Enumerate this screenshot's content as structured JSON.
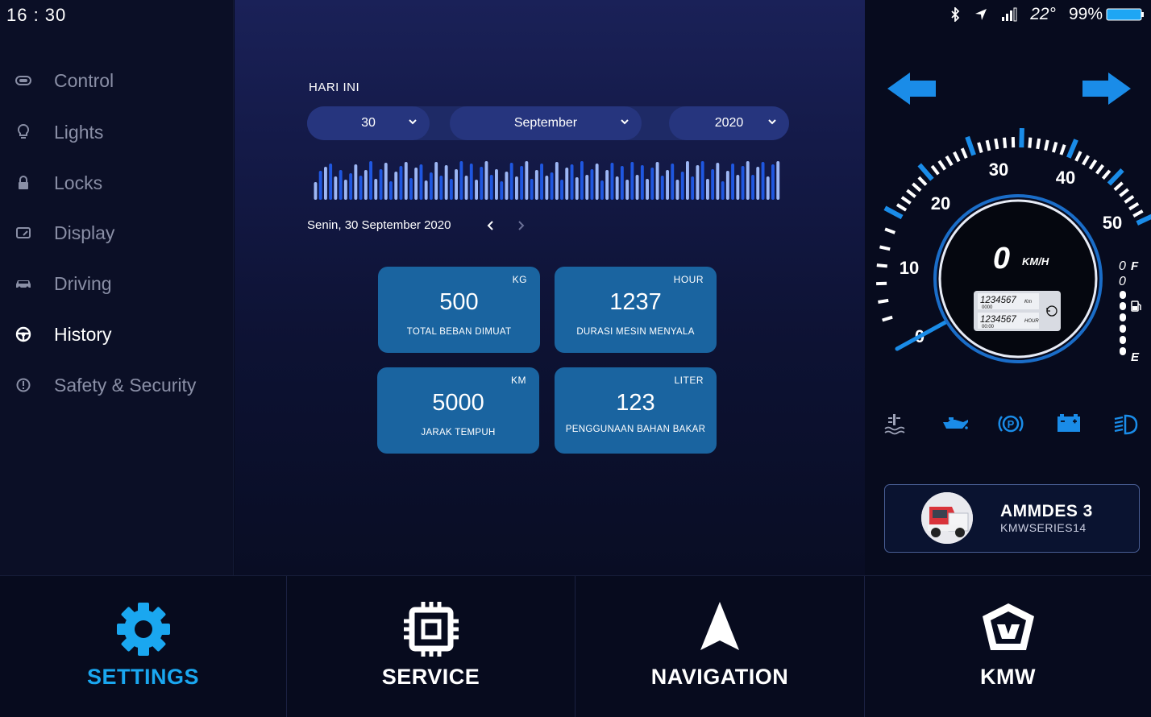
{
  "status_bar": {
    "time": "16 : 30",
    "temperature": "22°",
    "battery": "99%"
  },
  "sidebar": {
    "items": [
      {
        "label": "Control",
        "icon": "toggle-icon",
        "active": false
      },
      {
        "label": "Lights",
        "icon": "bulb-icon",
        "active": false
      },
      {
        "label": "Locks",
        "icon": "lock-icon",
        "active": false
      },
      {
        "label": "Display",
        "icon": "display-icon",
        "active": false
      },
      {
        "label": "Driving",
        "icon": "car-icon",
        "active": false
      },
      {
        "label": "History",
        "icon": "steering-wheel-icon",
        "active": true
      },
      {
        "label": "Safety & Security",
        "icon": "info-icon",
        "active": false
      }
    ]
  },
  "history": {
    "section_title": "HARI INI",
    "day": "30",
    "month": "September",
    "year": "2020",
    "date_label": "Senin, 30 September 2020",
    "bar_levels": [
      0.42,
      0.7,
      0.78,
      0.86,
      0.55,
      0.72,
      0.48,
      0.64,
      0.84,
      0.58,
      0.71,
      0.93,
      0.5,
      0.74,
      0.88,
      0.44,
      0.67,
      0.8,
      0.9,
      0.52,
      0.76,
      0.85,
      0.46,
      0.66,
      0.9,
      0.58,
      0.82,
      0.5,
      0.73,
      0.93,
      0.57,
      0.86,
      0.49,
      0.78,
      0.92,
      0.6,
      0.74,
      0.45,
      0.68,
      0.88,
      0.55,
      0.8,
      0.93,
      0.5,
      0.72,
      0.86,
      0.58,
      0.66,
      0.9,
      0.48,
      0.77,
      0.84,
      0.53,
      0.93,
      0.6,
      0.74,
      0.86,
      0.47,
      0.71,
      0.89,
      0.55,
      0.8,
      0.48,
      0.9,
      0.6,
      0.82,
      0.5,
      0.76,
      0.9,
      0.58,
      0.72,
      0.86,
      0.48,
      0.68,
      0.92,
      0.55,
      0.82,
      0.93,
      0.5,
      0.74,
      0.88,
      0.45,
      0.7,
      0.86,
      0.6,
      0.8,
      0.93,
      0.6,
      0.78,
      0.9,
      0.55,
      0.84,
      0.93
    ],
    "colors": {
      "bar_light": "#9db7f5",
      "bar_dark": "#1f57e0",
      "card": "#1a64a0"
    },
    "cards": [
      {
        "unit": "KG",
        "value": "500",
        "caption": "TOTAL BEBAN DIMUAT"
      },
      {
        "unit": "HOUR",
        "value": "1237",
        "caption": "DURASI MESIN MENYALA"
      },
      {
        "unit": "KM",
        "value": "5000",
        "caption": "JARAK TEMPUH"
      },
      {
        "unit": "LITER",
        "value": "123",
        "caption": "PENGGUNAAN BAHAN BAKAR"
      }
    ]
  },
  "dashboard": {
    "speed": "0",
    "speed_unit": "KM/H",
    "odometer": "1234567",
    "odometer_unit": "Km",
    "odometer_sub": "0000",
    "hour_meter": "1234567",
    "hour_unit": "HOUR",
    "hour_sub": "00:00",
    "scale_labels": [
      "0",
      "10",
      "20",
      "30",
      "40",
      "50"
    ],
    "fuel_full": "F",
    "fuel_empty": "E",
    "fuel_zero_a": "0",
    "fuel_zero_b": "0",
    "accent": "#1a8ce8",
    "warning_icons": [
      "coolant-temp-icon",
      "oil-pressure-icon",
      "parking-brake-icon",
      "battery-icon",
      "headlight-icon"
    ]
  },
  "vehicle": {
    "name": "AMMDES 3",
    "code": "KMWSERIES14"
  },
  "bottom_nav": [
    {
      "label": "SETTINGS",
      "icon": "gear-icon",
      "active": true
    },
    {
      "label": "SERVICE",
      "icon": "chip-icon",
      "active": false
    },
    {
      "label": "NAVIGATION",
      "icon": "navigation-arrow-icon",
      "active": false
    },
    {
      "label": "KMW",
      "icon": "kmw-logo-icon",
      "active": false
    }
  ]
}
